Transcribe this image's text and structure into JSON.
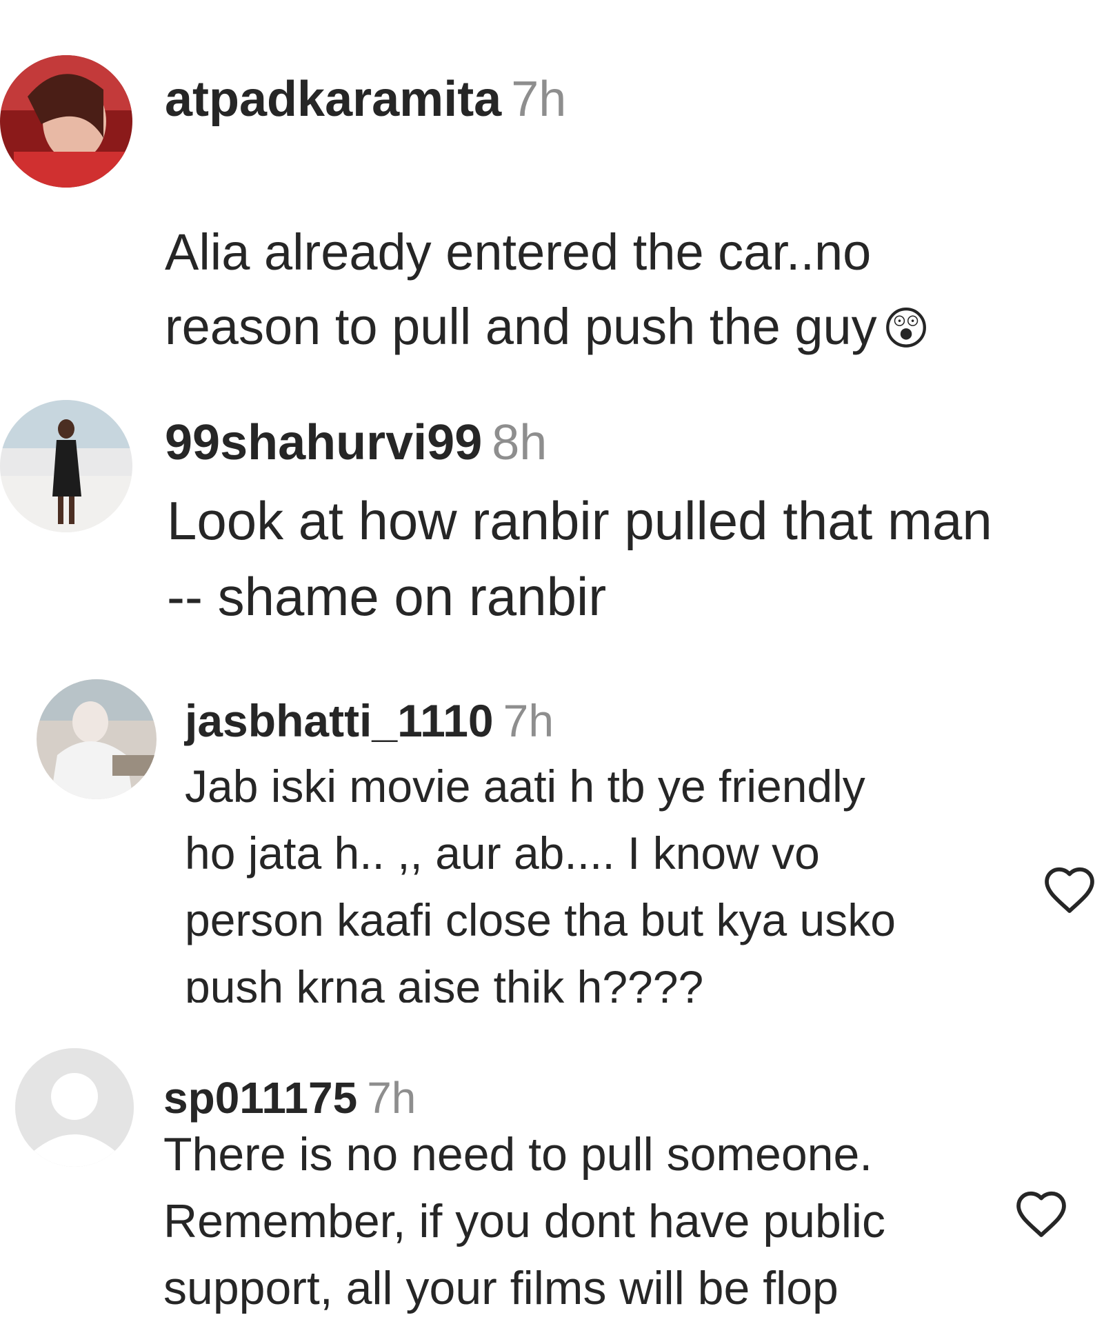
{
  "comments": [
    {
      "username": "atpadkaramita",
      "time": "7h",
      "text": "Alia already entered the car..no\nreason to pull and push the guy",
      "emoji": "😲",
      "liked_icon": "heart-outline-icon"
    },
    {
      "username": "99shahurvi99",
      "time": "8h",
      "text": "Look at how ranbir pulled that man\n-- shame on ranbir"
    },
    {
      "username": "jasbhatti_1110",
      "time": "7h",
      "text": "Jab iski movie aati h tb ye friendly\nho jata h.. ,, aur ab.... I know vo\nperson kaafi close tha but kya usko\npush krna aise thik h????"
    },
    {
      "username": "sp011175",
      "time": "7h",
      "text": "There is no need to pull someone.\nRemember, if you dont have public\nsupport, all your films will be flop"
    }
  ],
  "colors": {
    "text": "#262626",
    "muted": "#8e8e8e",
    "avatar_placeholder": "#dbdbdb"
  }
}
